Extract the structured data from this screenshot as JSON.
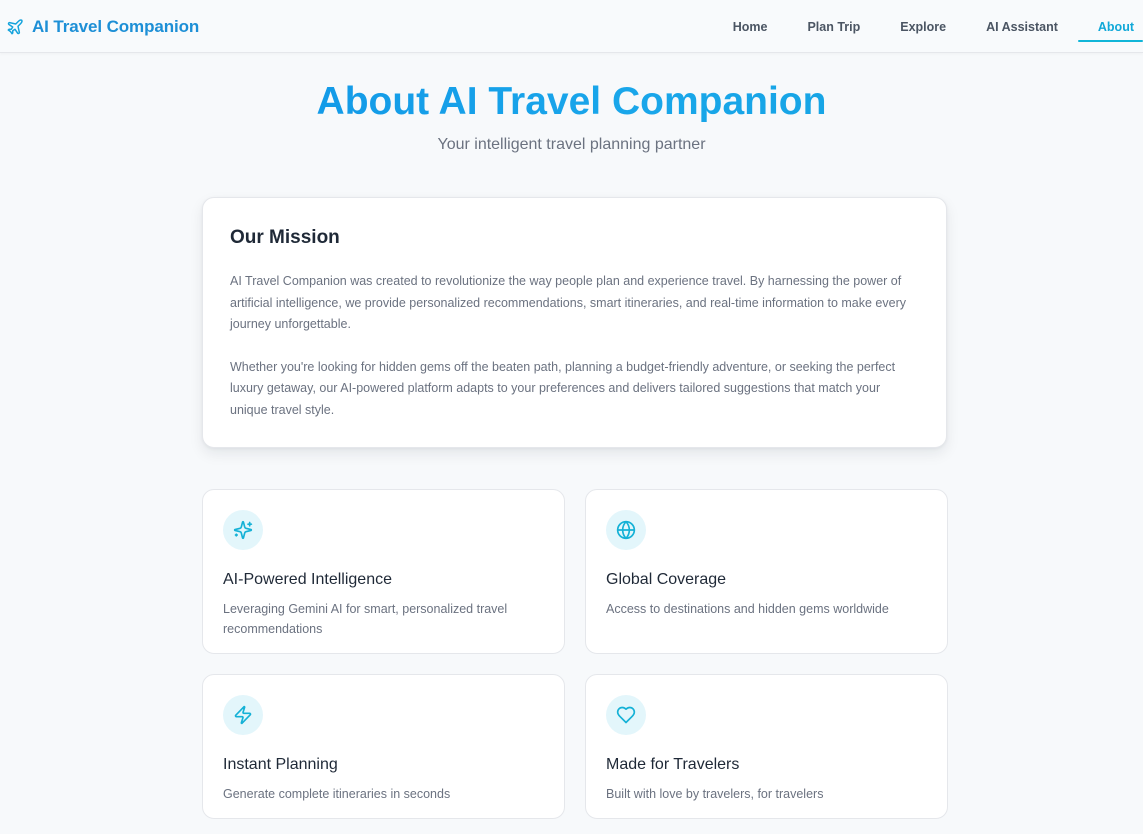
{
  "brand": {
    "name": "AI Travel Companion",
    "icon": "plane-icon",
    "color": "#1d8fd6"
  },
  "nav": {
    "items": [
      {
        "label": "Home",
        "active": false
      },
      {
        "label": "Plan Trip",
        "active": false
      },
      {
        "label": "Explore",
        "active": false
      },
      {
        "label": "AI Assistant",
        "active": false
      },
      {
        "label": "About",
        "active": true
      }
    ],
    "active_color": "#11a8d8"
  },
  "hero": {
    "title": "About AI Travel Companion",
    "subtitle": "Your intelligent travel planning partner"
  },
  "mission": {
    "title": "Our Mission",
    "paragraphs": [
      "AI Travel Companion was created to revolutionize the way people plan and experience travel. By harnessing the power of artificial intelligence, we provide personalized recommendations, smart itineraries, and real-time information to make every journey unforgettable.",
      "Whether you're looking for hidden gems off the beaten path, planning a budget-friendly adventure, or seeking the perfect luxury getaway, our AI-powered platform adapts to your preferences and delivers tailored suggestions that match your unique travel style."
    ]
  },
  "features": [
    {
      "icon": "sparkles-icon",
      "title": "AI-Powered Intelligence",
      "description": "Leveraging Gemini AI for smart, personalized travel recommendations"
    },
    {
      "icon": "globe-icon",
      "title": "Global Coverage",
      "description": "Access to destinations and hidden gems worldwide"
    },
    {
      "icon": "lightning-icon",
      "title": "Instant Planning",
      "description": "Generate complete itineraries in seconds"
    },
    {
      "icon": "heart-icon",
      "title": "Made for Travelers",
      "description": "Built with love by travelers, for travelers"
    }
  ],
  "colors": {
    "accent": "#11b5d8",
    "title_gradient_start": "#0d8fe6",
    "title_gradient_end": "#13a3df",
    "icon_bg": "#e3f6fb",
    "icon_stroke": "#14b1d6"
  }
}
